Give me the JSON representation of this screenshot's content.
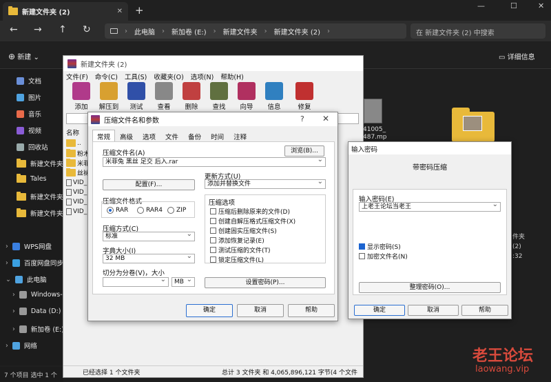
{
  "explorer": {
    "tab_title": "新建文件夹 (2)",
    "tab_close": "✕",
    "new_tab": "+",
    "window_controls": [
      "—",
      "☐",
      "✕"
    ],
    "nav_buttons": [
      "←",
      "→",
      "↑",
      "↻"
    ],
    "breadcrumb": [
      "此电脑",
      "新加卷 (E:)",
      "新建文件夹",
      "新建文件夹 (2)"
    ],
    "breadcrumb_sep": "›",
    "search_placeholder": "在 新建文件夹 (2) 中搜索",
    "new_button": "新建",
    "details_button": "详细信息",
    "sidebar": [
      {
        "label": "文档",
        "icon": "document-icon",
        "color": "#6a8fd8"
      },
      {
        "label": "图片",
        "icon": "picture-icon",
        "color": "#4fa3e0"
      },
      {
        "label": "音乐",
        "icon": "music-icon",
        "color": "#e86a4a"
      },
      {
        "label": "视频",
        "icon": "video-icon",
        "color": "#8a5cd6"
      },
      {
        "label": "回收站",
        "icon": "recycle-bin-icon",
        "color": "#9aa"
      },
      {
        "label": "新建文件夹",
        "icon": "folder-icon",
        "color": "#e8b93a"
      },
      {
        "label": "Tales",
        "icon": "folder-icon",
        "color": "#e8b93a"
      },
      {
        "label": "新建文件夹",
        "icon": "folder-icon",
        "color": "#e8b93a"
      },
      {
        "label": "新建文件夹 (2)",
        "icon": "folder-icon",
        "color": "#e8b93a"
      },
      {
        "label": "WPS网盘",
        "icon": "cloud-icon",
        "color": "#3a7fe0"
      },
      {
        "label": "百度网盘同步",
        "icon": "cloud-icon",
        "color": "#3a9fe0"
      },
      {
        "label": "此电脑",
        "icon": "computer-icon",
        "color": "#4fa3e0"
      },
      {
        "label": "Windows-",
        "icon": "drive-icon",
        "color": "#999"
      },
      {
        "label": "Data (D:)",
        "icon": "drive-icon",
        "color": "#999"
      },
      {
        "label": "新加卷 (E:)",
        "icon": "drive-icon",
        "color": "#999"
      },
      {
        "label": "网络",
        "icon": "network-icon",
        "color": "#4fa3e0"
      }
    ],
    "status": "7 个项目  选中 1 个",
    "thumb_label_1": "41005_",
    "thumb_label_2": "487.mp",
    "right_labels": [
      "件夹",
      "(2)",
      ":32"
    ]
  },
  "rar": {
    "title": "新建文件夹 (2)",
    "menu": [
      "文件(F)",
      "命令(C)",
      "工具(S)",
      "收藏夹(O)",
      "选项(N)",
      "帮助(H)"
    ],
    "toolbar": [
      {
        "label": "添加",
        "color": "#b03a8a"
      },
      {
        "label": "解压到",
        "color": "#d8a030"
      },
      {
        "label": "测试",
        "color": "#3050a8"
      },
      {
        "label": "查看",
        "color": "#888"
      },
      {
        "label": "删除",
        "color": "#c04040"
      },
      {
        "label": "查找",
        "color": "#607040"
      },
      {
        "label": "向导",
        "color": "#b03060"
      },
      {
        "label": "信息",
        "color": "#3080c0"
      },
      {
        "label": "修复",
        "color": "#c03030"
      }
    ],
    "list_header": "名称",
    "rows": [
      "..",
      "粉木",
      "米菲",
      "丝袜",
      "VID_",
      "VID_",
      "VID_",
      "VID_"
    ],
    "status_left": "已经选择 1 个文件夹",
    "status_right": "总计 3 文件夹 和 4,065,896,121 字节(4 个文件"
  },
  "dialog": {
    "title": "压缩文件名和参数",
    "help": "?",
    "close": "✕",
    "tabs": [
      "常规",
      "高级",
      "选项",
      "文件",
      "备份",
      "时间",
      "注释"
    ],
    "archive_name_label": "压缩文件名(A)",
    "browse_button": "浏览(B)...",
    "archive_name": "米菲兔 黑丝 足交 后入.rar",
    "profile_button": "配置(F)...",
    "update_mode_label": "更新方式(U)",
    "update_mode": "添加并替换文件",
    "format_label": "压缩文件格式",
    "formats": [
      "RAR",
      "RAR4",
      "ZIP"
    ],
    "selected_format": "RAR",
    "method_label": "压缩方式(C)",
    "method": "标准",
    "dict_label": "字典大小(I)",
    "dict": "32 MB",
    "split_label": "切分为分卷(V)，大小",
    "split_unit": "MB",
    "options_label": "压缩选项",
    "options": [
      {
        "label": "压缩后删除原来的文件(D)",
        "checked": false
      },
      {
        "label": "创建自解压格式压缩文件(X)",
        "checked": false
      },
      {
        "label": "创建固实压缩文件(S)",
        "checked": false
      },
      {
        "label": "添加恢复记录(E)",
        "checked": false
      },
      {
        "label": "测试压缩的文件(T)",
        "checked": false
      },
      {
        "label": "锁定压缩文件(L)",
        "checked": false
      }
    ],
    "set_password_button": "设置密码(P)...",
    "ok": "确定",
    "cancel": "取消",
    "help_button": "帮助"
  },
  "password": {
    "title": "输入密码",
    "heading": "带密码压缩",
    "input_label": "输入密码(E)",
    "input_value": "上老王论坛当老王",
    "show_password": "显示密码(S)",
    "show_password_checked": true,
    "encrypt_names": "加密文件名(N)",
    "encrypt_names_checked": false,
    "organize_button": "整理密码(O)...",
    "ok": "确定",
    "cancel": "取消",
    "help": "帮助"
  },
  "watermark": {
    "logo": "老王论坛",
    "url": "laowang.vip"
  }
}
